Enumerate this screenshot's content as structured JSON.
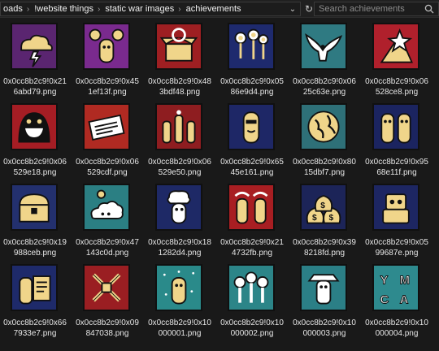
{
  "breadcrumb": [
    "oads",
    "!website things",
    "static war images",
    "achievements"
  ],
  "search": {
    "placeholder": "Search achievements"
  },
  "files": [
    {
      "name_l1": "0x0cc8b2c9!0x21",
      "name_l2": "6abd79.png",
      "bg": "#5a2570",
      "icon": "storm-cloud-icon"
    },
    {
      "name_l1": "0x0cc8b2c9!0x45",
      "name_l2": "1ef13f.png",
      "bg": "#7a2a8e",
      "icon": "money-bag-figure-icon"
    },
    {
      "name_l1": "0x0cc8b2c9!0x48",
      "name_l2": "3bdf48.png",
      "bg": "#9e1f22",
      "icon": "open-box-icon"
    },
    {
      "name_l1": "0x0cc8b2c9!0x05",
      "name_l2": "86e9d4.png",
      "bg": "#1e2a6e",
      "icon": "flowers-icon"
    },
    {
      "name_l1": "0x0cc8b2c9!0x06",
      "name_l2": "25c63e.png",
      "bg": "#2f7a82",
      "icon": "eagle-icon"
    },
    {
      "name_l1": "0x0cc8b2c9!0x06",
      "name_l2": "528ce8.png",
      "bg": "#b0202c",
      "icon": "star-rising-icon"
    },
    {
      "name_l1": "0x0cc8b2c9!0x06",
      "name_l2": "529e18.png",
      "bg": "#a51d24",
      "icon": "grinning-monster-icon"
    },
    {
      "name_l1": "0x0cc8b2c9!0x06",
      "name_l2": "529cdf.png",
      "bg": "#b02a22",
      "icon": "newspaper-icon"
    },
    {
      "name_l1": "0x0cc8b2c9!0x06",
      "name_l2": "529e50.png",
      "bg": "#8e1d20",
      "icon": "party-crowd-icon"
    },
    {
      "name_l1": "0x0cc8b2c9!0x65",
      "name_l2": "45e161.png",
      "bg": "#1e2766",
      "icon": "agent-figure-icon"
    },
    {
      "name_l1": "0x0cc8b2c9!0x80",
      "name_l2": "15dbf7.png",
      "bg": "#2e7078",
      "icon": "globe-icon"
    },
    {
      "name_l1": "0x0cc8b2c9!0x95",
      "name_l2": "68e11f.png",
      "bg": "#1b2460",
      "icon": "twin-figures-icon"
    },
    {
      "name_l1": "0x0cc8b2c9!0x19",
      "name_l2": "988ceb.png",
      "bg": "#23306e",
      "icon": "treasure-chest-icon"
    },
    {
      "name_l1": "0x0cc8b2c9!0x47",
      "name_l2": "143c0d.png",
      "bg": "#2b7f83",
      "icon": "idea-cloud-icon"
    },
    {
      "name_l1": "0x0cc8b2c9!0x18",
      "name_l2": "1282d4.png",
      "bg": "#1e2966",
      "icon": "chef-icon"
    },
    {
      "name_l1": "0x0cc8b2c9!0x21",
      "name_l2": "4732fb.png",
      "bg": "#a81e22",
      "icon": "tornado-twins-icon"
    },
    {
      "name_l1": "0x0cc8b2c9!0x39",
      "name_l2": "8218fd.png",
      "bg": "#1c2458",
      "icon": "money-bags-icon"
    },
    {
      "name_l1": "0x0cc8b2c9!0x05",
      "name_l2": "99687e.png",
      "bg": "#1d2662",
      "icon": "robot-icon"
    },
    {
      "name_l1": "0x0cc8b2c9!0x66",
      "name_l2": "7933e7.png",
      "bg": "#1e2a6a",
      "icon": "document-soldier-icon"
    },
    {
      "name_l1": "0x0cc8b2c9!0x09",
      "name_l2": "847038.png",
      "bg": "#9a1e22",
      "icon": "crossed-swords-icon"
    },
    {
      "name_l1": "0x0cc8b2c9!0x10",
      "name_l2": "000001.png",
      "bg": "#2a8a8a",
      "icon": "confetti-figure-icon"
    },
    {
      "name_l1": "0x0cc8b2c9!0x10",
      "name_l2": "000002.png",
      "bg": "#2c8588",
      "icon": "three-heads-icon"
    },
    {
      "name_l1": "0x0cc8b2c9!0x10",
      "name_l2": "000003.png",
      "bg": "#2b7f86",
      "icon": "cowboy-icon"
    },
    {
      "name_l1": "0x0cc8b2c9!0x10",
      "name_l2": "000004.png",
      "bg": "#2e8a8e",
      "icon": "letters-figures-icon"
    }
  ]
}
